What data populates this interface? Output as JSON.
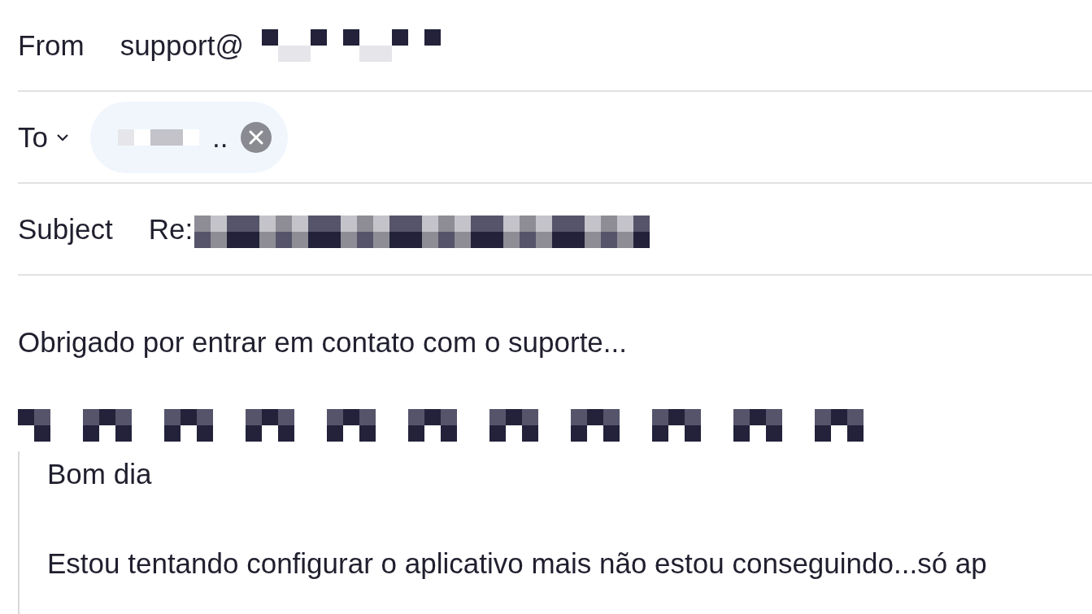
{
  "header": {
    "from": {
      "label": "From",
      "value": "support@"
    },
    "to": {
      "label": "To",
      "recipients": [
        {
          "text": ".."
        }
      ]
    },
    "subject": {
      "label": "Subject",
      "value": "Re:"
    }
  },
  "body": {
    "message": "Obrigado por entrar em contato com o suporte...",
    "quote": [
      "Bom dia",
      "Estou tentando configurar o aplicativo mais não estou conseguindo...só ap"
    ]
  }
}
